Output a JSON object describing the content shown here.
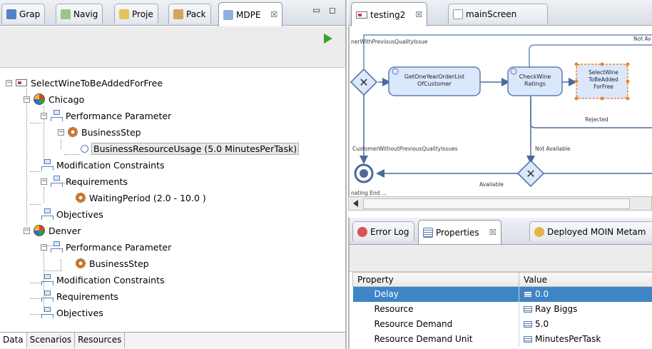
{
  "left_panel": {
    "tabs": [
      {
        "label": "Grap",
        "icon": "graph-icon"
      },
      {
        "label": "Navig",
        "icon": "navigator-icon"
      },
      {
        "label": "Proje",
        "icon": "project-icon"
      },
      {
        "label": "Pack",
        "icon": "package-icon"
      },
      {
        "label": "MDPE",
        "icon": "mdpe-icon",
        "close": "☒"
      }
    ],
    "tree": {
      "root": "SelectWineToBeAddedForFree",
      "chicago": "Chicago",
      "chicago_perf": "Performance Parameter",
      "chicago_step": "BusinessStep",
      "chicago_usage": "BusinessResourceUsage (5.0 MinutesPerTask)",
      "chicago_mod": "Modification Constraints",
      "chicago_req": "Requirements",
      "chicago_wait": "WaitingPeriod (2.0 - 10.0 )",
      "chicago_obj": "Objectives",
      "denver": "Denver",
      "denver_perf": "Performance Parameter",
      "denver_step": "BusinessStep",
      "denver_mod": "Modification Constraints",
      "denver_req": "Requirements",
      "denver_obj": "Objectives"
    },
    "bottom_tabs": [
      "Data",
      "Scenarios",
      "Resources"
    ]
  },
  "editor": {
    "tabs": [
      {
        "label": "testing2",
        "close": "☒"
      },
      {
        "label": "mainScreen"
      }
    ],
    "diagram": {
      "flow_with_issue": "nerWithPreviousQualityIssue",
      "not_available_top": "Not Av",
      "task1": "GetOneYearOrderList OfCustomer",
      "task1_line1": "GetOneYearOrderList",
      "task1_line2": "OfCustomer",
      "task2_line1": "CheckWine",
      "task2_line2": "Ratings",
      "task3_line1": "SelectWine",
      "task3_line2": "ToBeAdded",
      "task3_line3": "ForFree",
      "rejected": "Rejected",
      "flow_without_issue": "CustomerWithoutPreviousQualityIssues",
      "not_available": "Not Available",
      "available": "Available",
      "end_label": "nating End ..."
    }
  },
  "properties": {
    "tabs": [
      {
        "label": "Error Log"
      },
      {
        "label": "Properties",
        "close": "☒"
      },
      {
        "label": "Deployed MOIN Metam"
      }
    ],
    "headers": [
      "Property",
      "Value"
    ],
    "rows": [
      {
        "property": "Delay",
        "value": "0.0",
        "selected": true
      },
      {
        "property": "Resource",
        "value": "Ray Biggs"
      },
      {
        "property": "Resource Demand",
        "value": "5.0"
      },
      {
        "property": "Resource Demand Unit",
        "value": "MinutesPerTask"
      }
    ]
  },
  "colors": {
    "selection": "#3d85c6",
    "task_fill": "#dbe7fb",
    "task_border": "#5b7fb6",
    "selected_task_border": "#e8862a",
    "run_green": "#3aa13a"
  }
}
